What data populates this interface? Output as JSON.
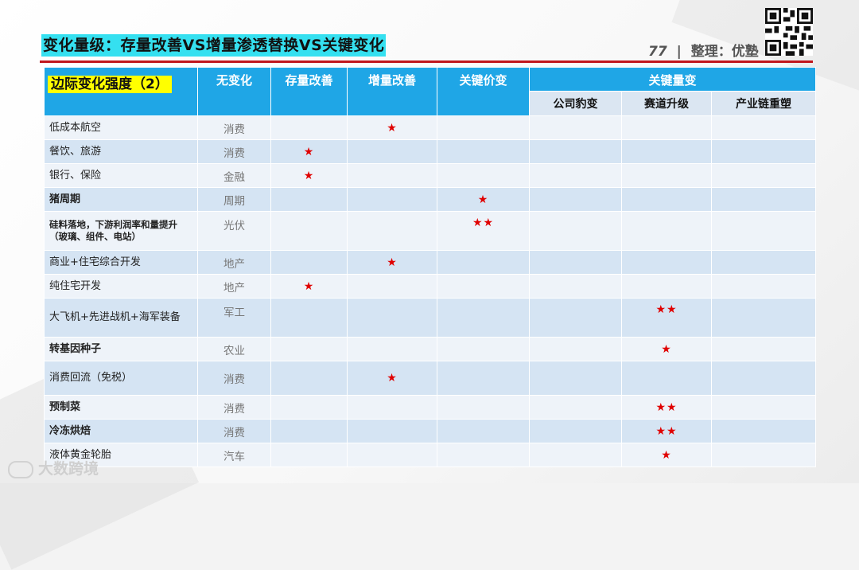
{
  "title": "变化量级：存量改善VS增量渗透替换VS关键变化",
  "page_number": "77",
  "separator": "|",
  "organizer": "整理：优塾",
  "table": {
    "corner_label": "边际变化强度（2）",
    "headers": {
      "no_change": "无变化",
      "stock_improve": "存量改善",
      "increment_improve": "增量改善",
      "key_price_change": "关键价变",
      "key_volume_change": "关键量变",
      "company_leap": "公司豹变",
      "track_upgrade": "赛道升级",
      "chain_reshape": "产业链重塑"
    },
    "rows": [
      {
        "name": "低成本航空",
        "sector": "消费",
        "stock": "",
        "incr": "★",
        "price": "",
        "leap": "",
        "track": "",
        "chain": ""
      },
      {
        "name": "餐饮、旅游",
        "sector": "消费",
        "stock": "★",
        "incr": "",
        "price": "",
        "leap": "",
        "track": "",
        "chain": ""
      },
      {
        "name": "银行、保险",
        "sector": "金融",
        "stock": "★",
        "incr": "",
        "price": "",
        "leap": "",
        "track": "",
        "chain": ""
      },
      {
        "name": "猪周期",
        "sector": "周期",
        "stock": "",
        "incr": "",
        "price": "★",
        "leap": "",
        "track": "",
        "chain": ""
      },
      {
        "name": "硅料落地，下游利润率和量提升（玻璃、组件、电站）",
        "sector": "光伏",
        "stock": "",
        "incr": "",
        "price": "★★",
        "leap": "",
        "track": "",
        "chain": ""
      },
      {
        "name": "商业+住宅综合开发",
        "sector": "地产",
        "stock": "",
        "incr": "★",
        "price": "",
        "leap": "",
        "track": "",
        "chain": ""
      },
      {
        "name": "纯住宅开发",
        "sector": "地产",
        "stock": "★",
        "incr": "",
        "price": "",
        "leap": "",
        "track": "",
        "chain": ""
      },
      {
        "name": "大飞机+先进战机+海军装备",
        "sector": "军工",
        "stock": "",
        "incr": "",
        "price": "",
        "leap": "",
        "track": "★★",
        "chain": ""
      },
      {
        "name": "转基因种子",
        "sector": "农业",
        "stock": "",
        "incr": "",
        "price": "",
        "leap": "",
        "track": "★",
        "chain": ""
      },
      {
        "name": "消费回流（免税）",
        "sector": "消费",
        "stock": "",
        "incr": "★",
        "price": "",
        "leap": "",
        "track": "",
        "chain": ""
      },
      {
        "name": "预制菜",
        "sector": "消费",
        "stock": "",
        "incr": "",
        "price": "",
        "leap": "",
        "track": "★★",
        "chain": ""
      },
      {
        "name": "冷冻烘焙",
        "sector": "消费",
        "stock": "",
        "incr": "",
        "price": "",
        "leap": "",
        "track": "★★",
        "chain": ""
      },
      {
        "name": "液体黄金轮胎",
        "sector": "汽车",
        "stock": "",
        "incr": "",
        "price": "",
        "leap": "",
        "track": "★",
        "chain": ""
      }
    ]
  },
  "watermark": "大数跨境",
  "colors": {
    "header_blue": "#1fa6e6",
    "title_cyan": "#35e0f0",
    "rule_red": "#c0161d",
    "star_red": "#e00000",
    "highlight_yellow": "#ffff00"
  }
}
